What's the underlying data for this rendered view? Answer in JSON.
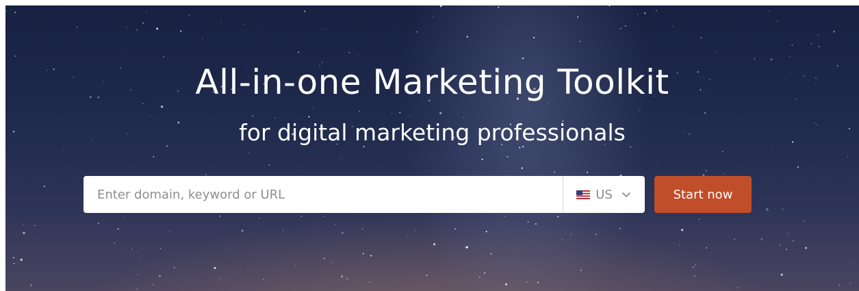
{
  "hero": {
    "title": "All-in-one Marketing Toolkit",
    "subtitle": "for digital marketing professionals"
  },
  "search": {
    "placeholder": "Enter domain, keyword or URL",
    "value": "",
    "region": {
      "label": "US",
      "flag_icon": "us-flag-icon",
      "dropdown_icon": "chevron-down-icon"
    },
    "submit_label": "Start now"
  },
  "colors": {
    "accent_button": "#c14e2a",
    "hero_background": "#1f2a4d",
    "text_light": "#ffffff"
  }
}
